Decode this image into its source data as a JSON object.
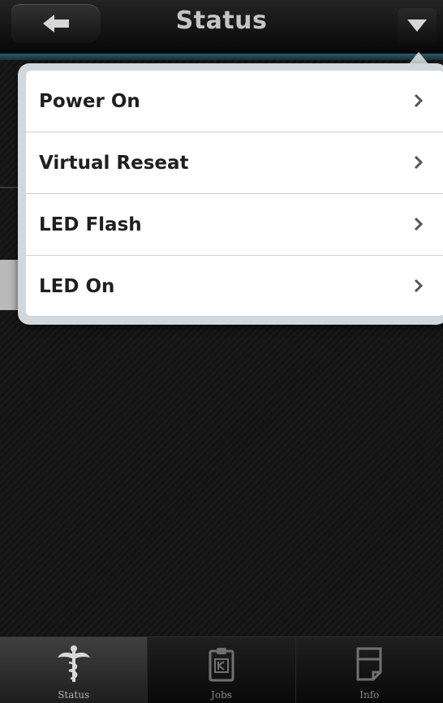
{
  "header": {
    "title": "Status",
    "back_icon": "back-arrow-icon",
    "menu_icon": "chevron-down-icon"
  },
  "menu": {
    "items": [
      {
        "label": "Power On",
        "icon": "chevron-right-icon"
      },
      {
        "label": "Virtual Reseat",
        "icon": "chevron-right-icon"
      },
      {
        "label": "LED Flash",
        "icon": "chevron-right-icon"
      },
      {
        "label": "LED On",
        "icon": "chevron-right-icon"
      }
    ]
  },
  "tabs": [
    {
      "label": "Status",
      "icon": "caduceus-icon",
      "active": true
    },
    {
      "label": "Jobs",
      "icon": "clipboard-icon",
      "active": false
    },
    {
      "label": "Info",
      "icon": "document-icon",
      "active": false
    }
  ],
  "colors": {
    "background": "#141414",
    "header": "#111111",
    "accent_line": "#2f5a64",
    "menu_bg": "#ffffff",
    "menu_text": "#1f1f1f"
  }
}
